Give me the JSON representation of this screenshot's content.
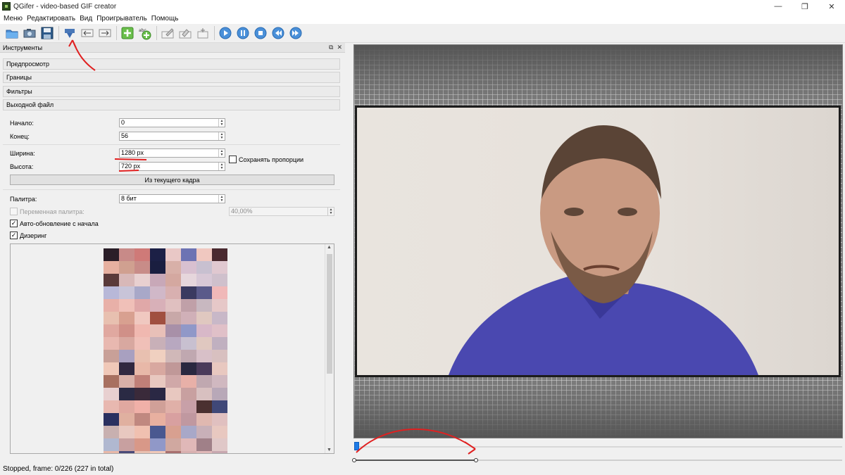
{
  "window": {
    "title": "QGifer - video-based GIF creator",
    "minimize": "—",
    "maximize": "❐",
    "close": "✕"
  },
  "menu": {
    "items": [
      "Меню",
      "Редактировать",
      "Вид",
      "Проигрыватель",
      "Помощь"
    ]
  },
  "tools_panel": {
    "title": "Инструменты",
    "float_icon": "⧉",
    "close_icon": "✕",
    "sections": [
      "Предпросмотр",
      "Границы",
      "Фильтры",
      "Выходной файл"
    ],
    "start_label": "Начало:",
    "start_value": "0",
    "end_label": "Конец:",
    "end_value": "56",
    "width_label": "Ширина:",
    "width_value": "1280 px",
    "height_label": "Высота:",
    "height_value": "720 px",
    "keep_ratio_label": "Сохранять пропорции",
    "keep_ratio_checked": false,
    "from_frame_button": "Из текущего кадра",
    "palette_label": "Палитра:",
    "palette_value": "8 бит",
    "variable_palette_label": "Переменная палитра:",
    "variable_palette_checked": false,
    "variable_palette_value": "40,00%",
    "auto_update_label": "Авто-обновление с начала",
    "auto_update_checked": true,
    "dithering_label": "Дизеринг",
    "dithering_checked": true,
    "palette_colors": [
      "#2a1e28",
      "#c88a88",
      "#cf7a78",
      "#1c2046",
      "#e9c8c6",
      "#6d73b3",
      "#f0c8c0",
      "#4a2a30",
      "#e6b0a0",
      "#d0a090",
      "#c88c88",
      "#1a1e40",
      "#d8b0a8",
      "#d8c0d0",
      "#c8c0d0",
      "#e0c8d0",
      "#5a3a3a",
      "#d8b8b8",
      "#e8d0d0",
      "#c8a8b8",
      "#d4a8a0",
      "#e6d6dc",
      "#d8c8d6",
      "#cfc0cc",
      "#b8b8d8",
      "#c8c4d8",
      "#a8a8c8",
      "#d0b8c8",
      "#d8b0b0",
      "#3a3a60",
      "#5a5a8a",
      "#f0b8b8",
      "#e8b0a8",
      "#f0c0b8",
      "#e0a8a8",
      "#d8b0b8",
      "#e0c0c0",
      "#c0a0a8",
      "#c8b8c0",
      "#e6c8c8",
      "#e8c0b0",
      "#d8a090",
      "#f0c8c0",
      "#a05040",
      "#c8a8a8",
      "#d0b0b8",
      "#e0c8c0",
      "#c8b8c8",
      "#e0a8a0",
      "#d09088",
      "#f0b8b0",
      "#e8c0b8",
      "#a890a8",
      "#9098c8",
      "#d8b8c8",
      "#e0c0c8",
      "#e8b8b0",
      "#d8a8a0",
      "#f0c0b8",
      "#c8b0b8",
      "#b8a8c0",
      "#c8c0d0",
      "#e0c8c0",
      "#c0b0c0",
      "#c8a098",
      "#a8a0c0",
      "#e8c0b0",
      "#f0d0c0",
      "#d0b8b8",
      "#c0a8b0",
      "#d8c0c8",
      "#d8c0c0",
      "#f0c8b8",
      "#302840",
      "#e8b8a8",
      "#d8a8a0",
      "#c09898",
      "#2a2840",
      "#4a3a5a",
      "#e8c8c0",
      "#a87060",
      "#d8b0a8",
      "#c08078",
      "#e8c8c0",
      "#d0a8a8",
      "#e8b0a8",
      "#c0a8b0",
      "#d0b8c0",
      "#e8d0d0",
      "#2a2a44",
      "#3a2a3a",
      "#2a2844",
      "#e8c8c0",
      "#c8a0a0",
      "#d8c0c0",
      "#b8a8b8",
      "#e8b8b0",
      "#e0a8a0",
      "#f0b0a8",
      "#d0a098",
      "#e0b0a8",
      "#c8a0a8",
      "#4a3030",
      "#404878",
      "#2a3060",
      "#e0b0a0",
      "#c08880",
      "#e8b0a0",
      "#d8a0a0",
      "#c098a0",
      "#e0b8b0",
      "#e0c0c0",
      "#c8b0b0",
      "#e8c8c0",
      "#f0c0b0",
      "#4a5890",
      "#d8a090",
      "#a8a8c8",
      "#c8b0b8",
      "#e8c8c0",
      "#b0b8d0",
      "#c8a0a0",
      "#d89888",
      "#9098c8",
      "#d0a8a0",
      "#e0b8b8",
      "#a08088",
      "#e0c8c8",
      "#e8b8a8",
      "#4a4a78",
      "#e8c0b0",
      "#f0c8b8",
      "#a87070",
      "#d8b0b0",
      "#e0b8b8",
      "#c8a8b0",
      "#c0a8b8",
      "#4a4870",
      "#d0a098",
      "#e8b8b0",
      "#d8a0a0",
      "#c09090",
      "#e8b0a8",
      "#d8a8a8"
    ]
  },
  "status": {
    "text": "Stopped, frame: 0/226 (227 in total)"
  },
  "player": {
    "position_fraction": 0.0,
    "range_start_fraction": 0.0,
    "range_end_fraction": 0.25
  }
}
